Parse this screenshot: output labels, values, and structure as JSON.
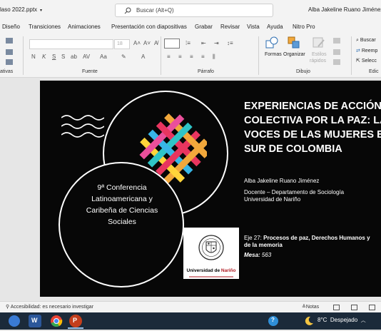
{
  "titlebar": {
    "file_name": "laso 2022.pptx",
    "search_placeholder": "Buscar (Alt+Q)",
    "user_name": "Alba Jakeline Ruano Jiménez"
  },
  "ribbon_tabs": [
    "Diseño",
    "Transiciones",
    "Animaciones",
    "Presentación con diapositivas",
    "Grabar",
    "Revisar",
    "Vista",
    "Ayuda",
    "Nitro Pro"
  ],
  "ribbon": {
    "groups": {
      "diapositivas": "ativas",
      "fuente": "Fuente",
      "parrafo": "Párrafo",
      "dibujo": "Dibujo",
      "edicion": "Edic"
    },
    "font_size": "18",
    "drawing_buttons": {
      "formas": "Formas",
      "organizar": "Organizar",
      "estilos_line1": "Estilos",
      "estilos_line2": "rápidos"
    },
    "edit_buttons": {
      "buscar": "Buscar",
      "reemplazar": "Reemp",
      "seleccionar": "Selecc"
    }
  },
  "slide": {
    "title_lines": [
      "EXPERIENCIAS DE ACCIÓN",
      "COLECTIVA POR LA PAZ: LA",
      "VOCES DE LAS MUJERES E",
      "SUR DE COLOMBIA"
    ],
    "conference_lines": [
      "9ª Conferencia",
      "Latinoamericana y",
      "Caribeña de Ciencias",
      "Sociales"
    ],
    "author": "Alba Jakeline Ruano Jiménez",
    "role": "Docente – Departamento de Sociología",
    "institution": "Universidad de Nariño",
    "eje_prefix": "Eje 27: ",
    "eje_text_line1": "Procesos de paz, Derechos Humanos y",
    "eje_text_line2": "de la memoria",
    "mesa_label": "Mesa:",
    "mesa_value": " 563",
    "logo": {
      "name_part1": "Universidad de ",
      "name_part2": "Nariño"
    }
  },
  "statusbar": {
    "accessibility": "Accesibilidad: es necesario investigar",
    "notes": "Notas"
  },
  "taskbar": {
    "weather_temp": "8°C",
    "weather_text": "Despejado"
  },
  "colors": {
    "weave": [
      "#e8355f",
      "#f2a83b",
      "#38b6e6",
      "#ffd43a",
      "#ea4f9b",
      "#2fc4c6"
    ],
    "slide_bg": "#070707",
    "taskbar_bg": "#1b2a3a"
  }
}
